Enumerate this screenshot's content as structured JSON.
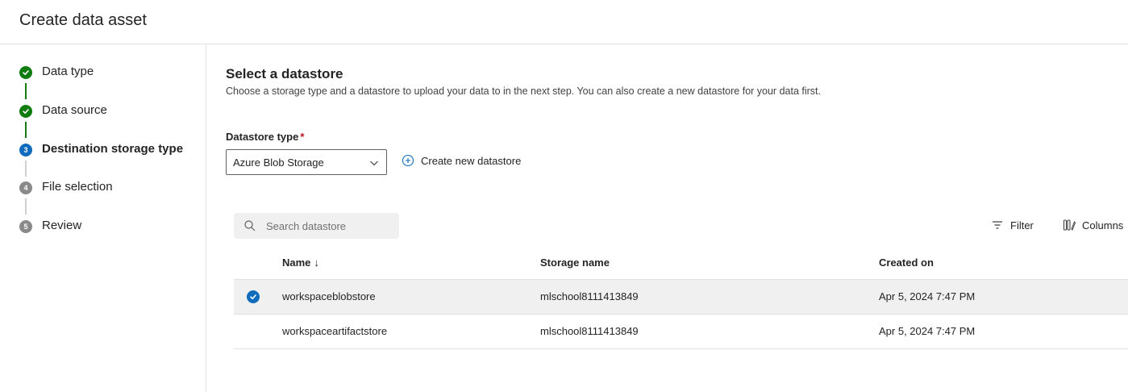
{
  "header": {
    "title": "Create data asset"
  },
  "steps": [
    {
      "label": "Data type",
      "status": "done",
      "marker": ""
    },
    {
      "label": "Data source",
      "status": "done",
      "marker": ""
    },
    {
      "label": "Destination storage type",
      "status": "current",
      "marker": "3"
    },
    {
      "label": "File selection",
      "status": "todo",
      "marker": "4"
    },
    {
      "label": "Review",
      "status": "todo",
      "marker": "5"
    }
  ],
  "main": {
    "title": "Select a datastore",
    "description": "Choose a storage type and a datastore to upload your data to in the next step. You can also create a new datastore for your data first.",
    "datastore_type": {
      "label": "Datastore type",
      "required_mark": "*",
      "value": "Azure Blob Storage"
    },
    "create_new_label": "Create new datastore",
    "search_placeholder": "Search datastore",
    "filter_label": "Filter",
    "columns_label": "Columns"
  },
  "table": {
    "headers": {
      "name": "Name",
      "sort_indicator": "↓",
      "storage": "Storage name",
      "created": "Created on"
    },
    "rows": [
      {
        "name": "workspaceblobstore",
        "storage": "mlschool8111413849",
        "created": "Apr 5, 2024 7:47 PM",
        "selected": true
      },
      {
        "name": "workspaceartifactstore",
        "storage": "mlschool8111413849",
        "created": "Apr 5, 2024 7:47 PM",
        "selected": false
      }
    ]
  },
  "colors": {
    "done": "#107c10",
    "current": "#0f6cbd",
    "todo": "#8a8a8a",
    "brand": "#0f6cbd",
    "required": "#c50f1f"
  },
  "icons": {
    "step_done": "checkmark-circle-icon",
    "dropdown": "chevron-down-icon",
    "create": "add-circle-icon",
    "search": "search-icon",
    "filter": "filter-icon",
    "columns": "columns-edit-icon",
    "row_selected": "checkmark-circle-icon"
  }
}
